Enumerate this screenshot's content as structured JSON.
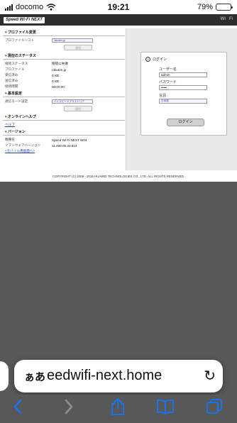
{
  "status_bar": {
    "carrier": "docomo",
    "time": "19:21",
    "battery": "79%",
    "battery_level": 0.79
  },
  "webpage": {
    "logo": "Speed Wi-Fi NEXT",
    "header_right": [
      "WI",
      "Fi"
    ],
    "sections": {
      "profile_change": {
        "title": "プロファイル変更",
        "profile_list_label": "プロファイルリスト",
        "profile_list_value": "rakuten.jp",
        "apply_button": "適用"
      },
      "status": {
        "title": "現在のステータス",
        "rows": [
          {
            "k": "接続ステータス",
            "v": "接続に失敗"
          },
          {
            "k": "プロファイル",
            "v": "rakuten.jp"
          },
          {
            "k": "受信済み",
            "v": "0 KB"
          },
          {
            "k": "送信済み",
            "v": "0 KB"
          },
          {
            "k": "接続時間",
            "v": "00:00:00"
          }
        ]
      },
      "basic": {
        "title": "基本設定",
        "mode_label": "通信モード設定",
        "mode_value": "ハイスピードプラスエリア",
        "apply_button": "適用"
      },
      "help": {
        "title": "オンラインヘルプ",
        "link": "ヘルプ"
      },
      "version": {
        "title": "バージョン",
        "rows": [
          {
            "k": "機種名",
            "v": "Speed Wi-Fi NEXT W04"
          },
          {
            "k": "ソフトウェアバージョン",
            "v": "11.460.05.34.824"
          }
        ],
        "mobile_link": "<モバイル用画面へ>"
      }
    },
    "login": {
      "title": "ログイン",
      "username_label": "ユーザー名",
      "username_value": "admin",
      "password_label": "パスワード",
      "password_value": "•••••",
      "language_label": "言語",
      "language_value": "日本語",
      "login_button": "ログイン"
    },
    "copyright": "COPYRIGHT (C) 2006 - 2016 HUAWEI TECHNOLOGIES CO., LTD. ALL RIGHTS RESERVED."
  },
  "address_bar": {
    "aa_label": "ぁあ",
    "url": "eedwifi-next.home",
    "reload_icon": "reload-icon"
  },
  "toolbar": {
    "icons": [
      "back-icon",
      "forward-icon",
      "share-icon",
      "bookmarks-icon",
      "tabs-icon"
    ]
  },
  "colors": {
    "accent": "#1a73e8",
    "page_bg": "#585858",
    "header_dark": "#2e2e2e"
  }
}
